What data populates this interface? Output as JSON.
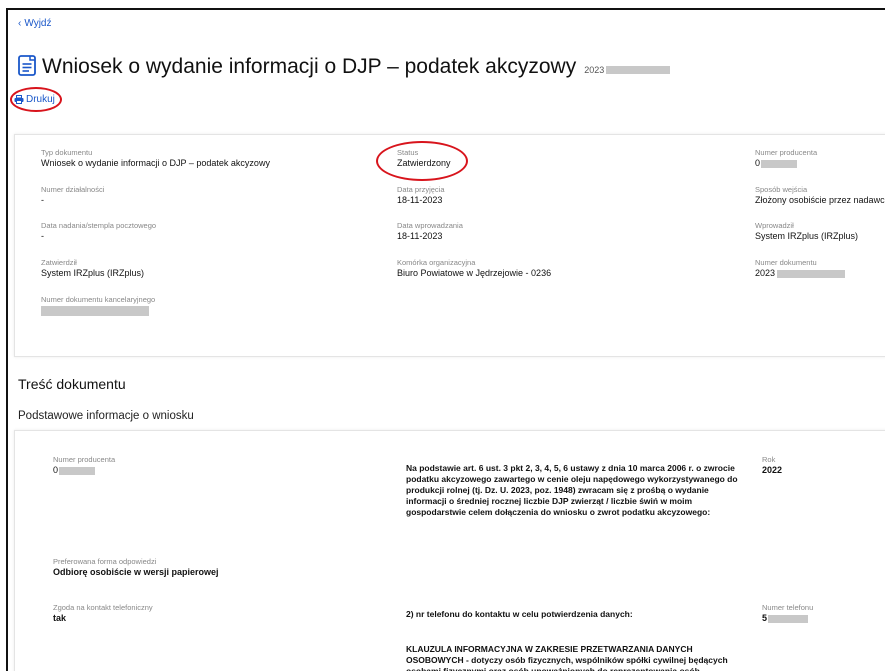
{
  "nav": {
    "back_label": "Wyjdź"
  },
  "header": {
    "title": "Wniosek o wydanie informacji o DJP – podatek akcyzowy",
    "number_prefix": "2023",
    "print_label": "Drukuj"
  },
  "details": {
    "typ_dokumentu": {
      "label": "Typ dokumentu",
      "value": "Wniosek o wydanie informacji o DJP – podatek akcyzowy"
    },
    "status": {
      "label": "Status",
      "value": "Zatwierdzony"
    },
    "numer_producenta": {
      "label": "Numer producenta",
      "value": "0"
    },
    "numer_dzialalnosci": {
      "label": "Numer działalności",
      "value": "-"
    },
    "data_przyjecia": {
      "label": "Data przyjęcia",
      "value": "18-11-2023"
    },
    "sposob_wejscia": {
      "label": "Sposób wejścia",
      "value": "Złożony osobiście przez nadawcę"
    },
    "data_nadania": {
      "label": "Data nadania/stempla pocztowego",
      "value": "-"
    },
    "data_wprowadzania": {
      "label": "Data wprowadzania",
      "value": "18-11-2023"
    },
    "wprowadzil": {
      "label": "Wprowadził",
      "value": "System IRZplus (IRZplus)"
    },
    "zatwierdzil": {
      "label": "Zatwierdził",
      "value": "System IRZplus (IRZplus)"
    },
    "komorka": {
      "label": "Komórka organizacyjna",
      "value": "Biuro Powiatowe w Jędrzejowie - 0236"
    },
    "numer_dokumentu": {
      "label": "Numer dokumentu",
      "value": "2023"
    },
    "numer_kancelaryjny": {
      "label": "Numer dokumentu kancelaryjnego",
      "value": ""
    }
  },
  "content": {
    "section_title": "Treść dokumentu",
    "subsection_title": "Podstawowe informacje o wniosku",
    "numer_producenta": {
      "label": "Numer producenta",
      "value": "0"
    },
    "legal_text": "Na podstawie art. 6 ust. 3 pkt 2, 3, 4, 5, 6 ustawy z dnia 10 marca 2006 r. o zwrocie podatku akcyzowego zawartego w cenie oleju napędowego wykorzystywanego do produkcji rolnej (tj. Dz. U. 2023, poz. 1948) zwracam się z prośbą o wydanie informacji o średniej rocznej liczbie DJP zwierząt / liczbie świń w moim gospodarstwie celem dołączenia do wniosku o zwrot podatku akcyzowego:",
    "rok": {
      "label": "Rok",
      "value": "2022"
    },
    "forma_odpowiedzi": {
      "label": "Preferowana forma odpowiedzi",
      "value": "Odbiorę osobiście w wersji papierowej"
    },
    "zgoda_kontakt": {
      "label": "Zgoda na kontakt telefoniczny",
      "value": "tak"
    },
    "phone_question": "2) nr telefonu do kontaktu w celu potwierdzenia danych:",
    "numer_telefonu": {
      "label": "Numer telefonu",
      "value": "5"
    },
    "klauzula": "KLAUZULA INFORMACYJNA W ZAKRESIE PRZETWARZANIA DANYCH OSOBOWYCH - dotyczy osób fizycznych, wspólników spółki cywilnej będących osobami fizycznymi oraz osób upoważnionych do reprezentowania osób"
  },
  "colors": {
    "link": "#1a57c9",
    "annotation": "#d8141c"
  }
}
